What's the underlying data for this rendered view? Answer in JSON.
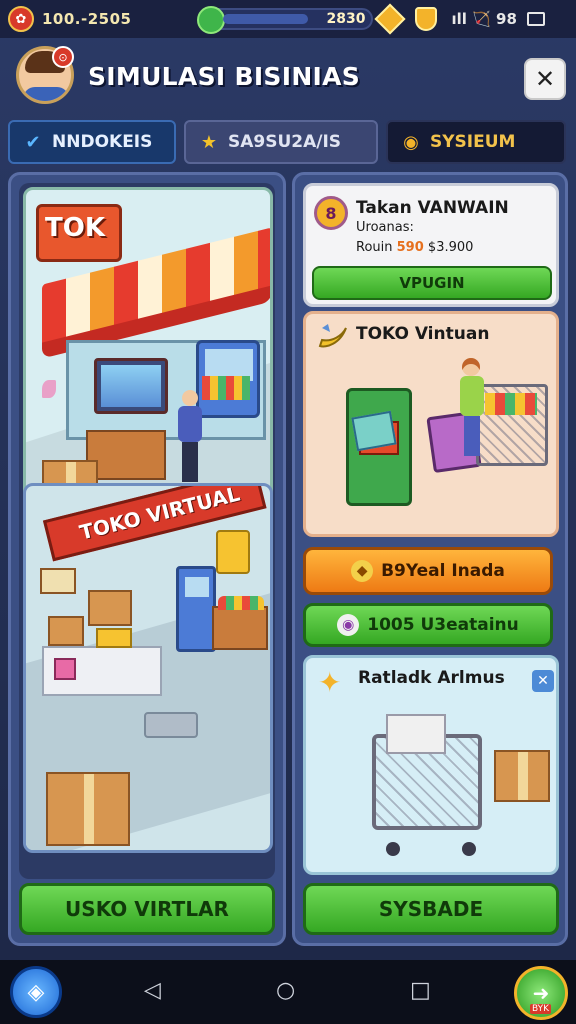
{
  "status_bar": {
    "time": "100.-2505",
    "progress_value": "2830",
    "progress_fraction": 0.72,
    "signal": "ıll 🏹 98"
  },
  "header": {
    "title": "SIMULASI BISINIAS",
    "avatar_badge": "⊙",
    "close_label": "✕"
  },
  "tabs": [
    {
      "label": "NNDOKEIS",
      "icon": "✔"
    },
    {
      "label": "SA9SU2A/IS",
      "icon": "★"
    },
    {
      "label": "SYSIEUM",
      "icon": "◉"
    }
  ],
  "left_panel": {
    "sign_top": "TOK",
    "banner": "TOKO VIRTUAL",
    "main_button": "USKO VIRTLAR"
  },
  "right_panel": {
    "card1": {
      "icon": "8",
      "title": "Takan VANWAIN",
      "subtitle": "Uroanas:",
      "price_prefix": "Rouin",
      "price_highlight": "590",
      "price_value": "$3.900",
      "button": "VPUGIN"
    },
    "card2": {
      "title": "TOKO Vintuan"
    },
    "orange_button": "B9Yeal Inada",
    "green_button": "1005 U3eatainu",
    "card3": {
      "title": "Ratladk Arlmus",
      "close": "✕"
    },
    "main_button": "SYSBADE"
  },
  "navbar": {
    "left_icon": "◈",
    "back": "◁",
    "home": "○",
    "recent": "□",
    "right_icon": "➜",
    "right_label": "BYK"
  },
  "colors": {
    "background": "#2b3a66",
    "green_button": "#35a823",
    "orange_button": "#ee7a14",
    "accent_red": "#d83a2a"
  }
}
